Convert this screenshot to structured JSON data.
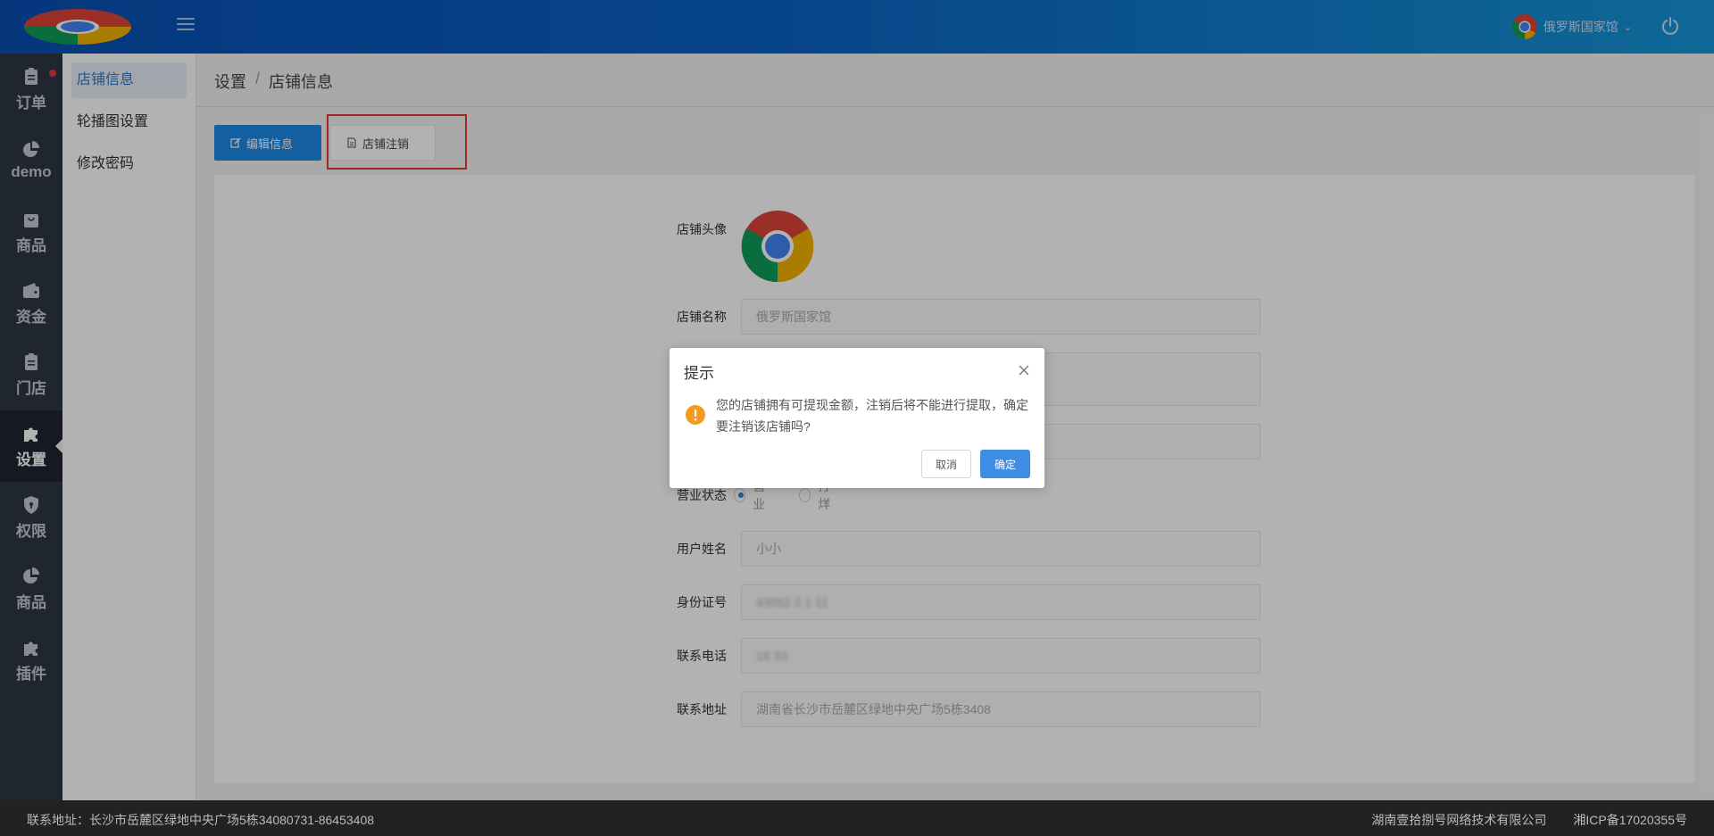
{
  "header": {
    "user_name": "俄罗斯国家馆",
    "colors": {
      "bar_start": "#0a4fb4",
      "bar_end": "#1696d8"
    }
  },
  "sidebar": {
    "items": [
      {
        "label": "订单",
        "icon": "clipboard-icon",
        "badge": true
      },
      {
        "label": "demo",
        "icon": "pie-chart-icon"
      },
      {
        "label": "商品",
        "icon": "bag-icon"
      },
      {
        "label": "资金",
        "icon": "wallet-icon"
      },
      {
        "label": "门店",
        "icon": "clipboard-icon"
      },
      {
        "label": "设置",
        "icon": "puzzle-icon",
        "active": true
      },
      {
        "label": "权限",
        "icon": "shield-icon"
      },
      {
        "label": "商品",
        "icon": "pie-chart-icon"
      },
      {
        "label": "插件",
        "icon": "puzzle-icon"
      }
    ]
  },
  "submenu": {
    "items": [
      {
        "label": "店铺信息",
        "active": true
      },
      {
        "label": "轮播图设置"
      },
      {
        "label": "修改密码"
      }
    ]
  },
  "breadcrumb": {
    "parent": "设置",
    "separator": "/",
    "current": "店铺信息"
  },
  "toolbar": {
    "edit_label": "编辑信息",
    "cancel_shop_label": "店铺注销"
  },
  "form": {
    "avatar_label": "店铺头像",
    "shop_name": {
      "label": "店铺名称",
      "placeholder": "俄罗斯国家馆"
    },
    "status": {
      "label": "营业状态",
      "options": [
        "营业",
        "打烊"
      ],
      "selected": "营业"
    },
    "user_name": {
      "label": "用户姓名",
      "placeholder": "小小"
    },
    "id_number": {
      "label": "身份证号",
      "placeholder": "43052 2 1 11"
    },
    "phone": {
      "label": "联系电话",
      "placeholder": "18 33"
    },
    "address": {
      "label": "联系地址",
      "placeholder": "湖南省长沙市岳麓区绿地中央广场5栋3408"
    }
  },
  "dialog": {
    "title": "提示",
    "message": "您的店铺拥有可提现金额，注销后将不能进行提取，确定要注销该店铺吗?",
    "cancel_label": "取消",
    "ok_label": "确定"
  },
  "footer": {
    "address": "联系地址：长沙市岳麓区绿地中央广场5栋34080731-86453408",
    "company": "湖南壹拾捌号网络技术有限公司",
    "icp": "湘ICP备17020355号"
  }
}
